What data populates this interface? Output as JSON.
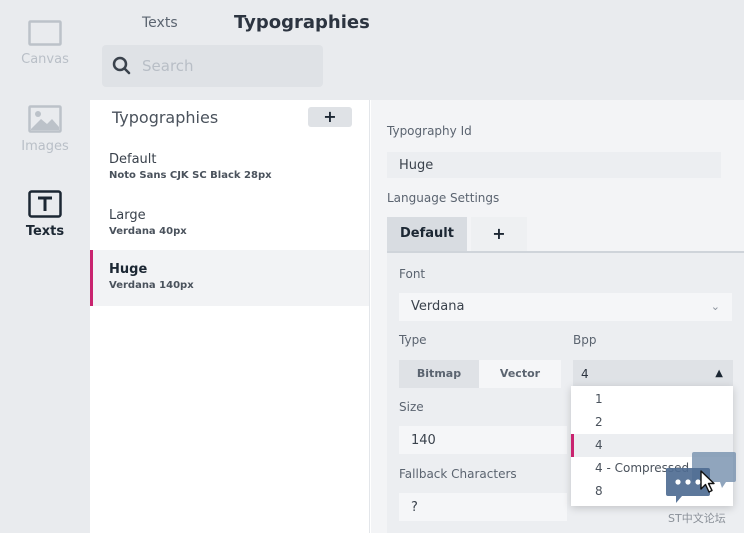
{
  "rail": {
    "items": [
      {
        "label": "Canvas",
        "icon": "canvas-icon"
      },
      {
        "label": "Images",
        "icon": "images-icon"
      },
      {
        "label": "Texts",
        "icon": "texts-icon"
      }
    ]
  },
  "header": {
    "tab_texts": "Texts",
    "title": "Typographies",
    "search_placeholder": "Search"
  },
  "list": {
    "heading": "Typographies",
    "add_label": "+",
    "items": [
      {
        "name": "Default",
        "desc": "Noto Sans CJK SC Black  28px"
      },
      {
        "name": "Large",
        "desc": "Verdana  40px"
      },
      {
        "name": "Huge",
        "desc": "Verdana  140px"
      }
    ]
  },
  "props": {
    "id_label": "Typography Id",
    "id_value": "Huge",
    "lang_label": "Language Settings",
    "lang_tabs": {
      "default": "Default",
      "add": "+"
    },
    "font_label": "Font",
    "font_value": "Verdana",
    "type_label": "Type",
    "type_options": [
      "Bitmap",
      "Vector"
    ],
    "bpp_label": "Bpp",
    "bpp_value": "4",
    "bpp_options": [
      "1",
      "2",
      "4",
      "4 - Compressed",
      "8"
    ],
    "size_label": "Size",
    "size_value": "140",
    "fallback_label": "Fallback Characters",
    "fallback_value": "?"
  },
  "watermark": {
    "text": "ST中文论坛"
  },
  "colors": {
    "accent": "#c9246f",
    "rail_bg": "#e9ebee",
    "panel_bg": "#f3f4f6"
  }
}
